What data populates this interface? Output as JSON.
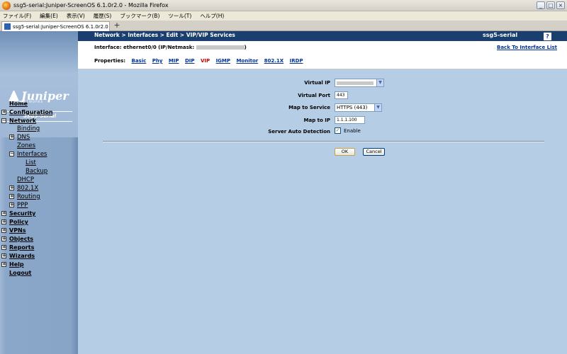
{
  "window": {
    "title": "ssg5-serial:Juniper-ScreenOS 6.1.0r2.0 - Mozilla Firefox"
  },
  "menubar": [
    "ファイル(F)",
    "編集(E)",
    "表示(V)",
    "履歴(S)",
    "ブックマーク(B)",
    "ツール(T)",
    "ヘルプ(H)"
  ],
  "tab": {
    "label": "ssg5-serial:Juniper-ScreenOS 6.1.0r2.0",
    "new_tab": "+"
  },
  "sidebar": {
    "logo_text": "Juniper",
    "logo_sub": "NETWORKS",
    "device_name": "SSG5-Serial",
    "items": {
      "home": "Home",
      "configuration": "Configuration",
      "network": "Network",
      "binding": "Binding",
      "dns": "DNS",
      "zones": "Zones",
      "interfaces": "Interfaces",
      "list": "List",
      "backup": "Backup",
      "dhcp": "DHCP",
      "x8021": "802.1X",
      "routing": "Routing",
      "ppp": "PPP",
      "security": "Security",
      "policy": "Policy",
      "vpns": "VPNs",
      "objects": "Objects",
      "reports": "Reports",
      "wizards": "Wizards",
      "help": "Help",
      "logout": "Logout"
    }
  },
  "header": {
    "breadcrumb": "Network > Interfaces > Edit > VIP/VIP Services",
    "device": "ssg5-serial",
    "help": "?"
  },
  "info": {
    "iface_prefix": "Interface: ethernet0/0 (IP/Netmask:",
    "iface_suffix": ")",
    "back_link": "Back To Interface List",
    "props_label": "Properties:",
    "props": [
      "Basic",
      "Phy",
      "MIP",
      "DIP",
      "VIP",
      "IGMP",
      "Monitor",
      "802.1X",
      "IRDP"
    ]
  },
  "form": {
    "virtual_ip_label": "Virtual IP",
    "virtual_port_label": "Virtual Port",
    "virtual_port_value": "443",
    "map_service_label": "Map to Service",
    "map_service_value": "HTTPS (443)",
    "map_ip_label": "Map to IP",
    "map_ip_value": "1.1.1.100",
    "server_detect_label": "Server Auto Detection",
    "enable_label": "Enable",
    "ok": "OK",
    "cancel": "Cancel"
  },
  "colors": {
    "header": "#1a3e6e",
    "main_bg": "#b6cde6",
    "active_prop": "#cc0000",
    "link": "#003399"
  }
}
